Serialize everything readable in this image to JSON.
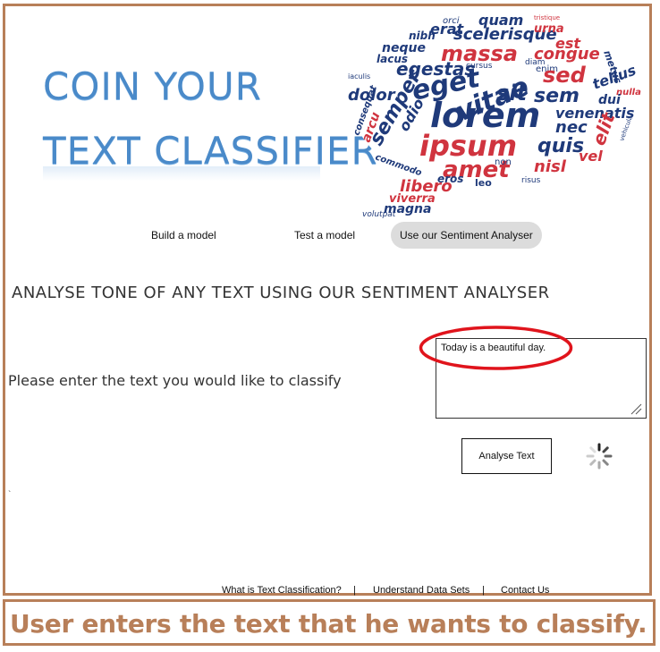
{
  "header": {
    "title_line1": "COIN YOUR",
    "title_line2": "TEXT CLASSIFIER"
  },
  "word_cloud": [
    {
      "t": "orci",
      "c": "#1f3a7a"
    },
    {
      "t": "quam",
      "c": "#1f3a7a"
    },
    {
      "t": "tristique",
      "c": "#d0343f"
    },
    {
      "t": "erat",
      "c": "#1f3a7a"
    },
    {
      "t": "scelerisque",
      "c": "#1f3a7a"
    },
    {
      "t": "urna",
      "c": "#d0343f"
    },
    {
      "t": "nibh",
      "c": "#1f3a7a"
    },
    {
      "t": "neque",
      "c": "#1f3a7a"
    },
    {
      "t": "massa",
      "c": "#d0343f"
    },
    {
      "t": "est",
      "c": "#d0343f"
    },
    {
      "t": "congue",
      "c": "#d0343f"
    },
    {
      "t": "metus",
      "c": "#1f3a7a"
    },
    {
      "t": "lacus",
      "c": "#1f3a7a"
    },
    {
      "t": "egestas",
      "c": "#1f3a7a"
    },
    {
      "t": "cursus",
      "c": "#1f3a7a"
    },
    {
      "t": "diam",
      "c": "#1f3a7a"
    },
    {
      "t": "enim",
      "c": "#1f3a7a"
    },
    {
      "t": "tellus",
      "c": "#1f3a7a"
    },
    {
      "t": "iaculis",
      "c": "#1f3a7a"
    },
    {
      "t": "eget",
      "c": "#1f3a7a"
    },
    {
      "t": "vitae",
      "c": "#1f3a7a"
    },
    {
      "t": "sed",
      "c": "#d0343f"
    },
    {
      "t": "nulla",
      "c": "#d0343f"
    },
    {
      "t": "dolor",
      "c": "#1f3a7a"
    },
    {
      "t": "sit",
      "c": "#1f3a7a"
    },
    {
      "t": "sem",
      "c": "#1f3a7a"
    },
    {
      "t": "dui",
      "c": "#1f3a7a"
    },
    {
      "t": "lorem",
      "c": "#1f3a7a"
    },
    {
      "t": "venenatis",
      "c": "#1f3a7a"
    },
    {
      "t": "semper",
      "c": "#1f3a7a"
    },
    {
      "t": "odio",
      "c": "#1f3a7a"
    },
    {
      "t": "nec",
      "c": "#1f3a7a"
    },
    {
      "t": "elit",
      "c": "#d0343f"
    },
    {
      "t": "consequat",
      "c": "#1f3a7a"
    },
    {
      "t": "arcu",
      "c": "#d0343f"
    },
    {
      "t": "ipsum",
      "c": "#d0343f"
    },
    {
      "t": "quis",
      "c": "#1f3a7a"
    },
    {
      "t": "vehicula",
      "c": "#1f3a7a"
    },
    {
      "t": "commodo",
      "c": "#1f3a7a"
    },
    {
      "t": "amet",
      "c": "#d0343f"
    },
    {
      "t": "vel",
      "c": "#d0343f"
    },
    {
      "t": "nisl",
      "c": "#d0343f"
    },
    {
      "t": "non",
      "c": "#1f3a7a"
    },
    {
      "t": "libero",
      "c": "#d0343f"
    },
    {
      "t": "eros",
      "c": "#1f3a7a"
    },
    {
      "t": "leo",
      "c": "#1f3a7a"
    },
    {
      "t": "risus",
      "c": "#1f3a7a"
    },
    {
      "t": "viverra",
      "c": "#d0343f"
    },
    {
      "t": "magna",
      "c": "#1f3a7a"
    },
    {
      "t": "volutpat",
      "c": "#1f3a7a"
    }
  ],
  "nav": {
    "build": "Build a  model",
    "test": "Test a model",
    "sentiment": "Use our Sentiment Analyser"
  },
  "main": {
    "section_title": "ANALYSE TONE OF ANY TEXT USING OUR SENTIMENT ANALYSER",
    "prompt_label": "Please enter the text you would like to classify",
    "input_value": "Today is a beautiful day.",
    "analyse_button": "Analyse Text",
    "stray_mark": "`"
  },
  "footer": {
    "what_is": "What is Text Classification?",
    "understand": "Understand Data Sets",
    "contact": "Contact Us",
    "separator": "|"
  },
  "caption": "User enters the text that he wants to classify.",
  "colors": {
    "frame_border": "#b87f59",
    "title_blue": "#4a8ac9",
    "cloud_navy": "#1f3a7a",
    "cloud_red": "#d0343f",
    "highlight_red": "#e0141c"
  }
}
